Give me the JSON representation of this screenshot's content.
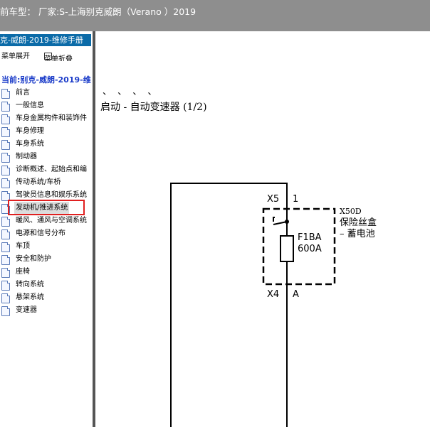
{
  "header": {
    "title": "前车型： 厂家:S-上海别克威朗（Verano ）2019"
  },
  "sidebar": {
    "manual_title": "克-威朗-2019-维修手册",
    "toolbar": {
      "expand_label": "菜单展开",
      "collapse_label": "菜单折叠"
    },
    "current_label": "当前:别克-威朗-2019-维",
    "items": [
      {
        "label": "前言"
      },
      {
        "label": "一般信息"
      },
      {
        "label": "车身金属构件和装饰件"
      },
      {
        "label": "车身修理"
      },
      {
        "label": "车身系统"
      },
      {
        "label": "制动器"
      },
      {
        "label": "诊断概述、起始点和编"
      },
      {
        "label": "传动系统/车桥"
      },
      {
        "label": "驾驶员信息和娱乐系统"
      },
      {
        "label": "发动机/推进系统"
      },
      {
        "label": "暖风、通风与空调系统"
      },
      {
        "label": "电源和信号分布"
      },
      {
        "label": "车顶"
      },
      {
        "label": "安全和防护"
      },
      {
        "label": "座椅"
      },
      {
        "label": "转向系统"
      },
      {
        "label": "悬架系统"
      },
      {
        "label": "变速器"
      }
    ],
    "selected_index": 9
  },
  "content": {
    "tick_marks": "、 、 、 、",
    "heading": "启动 - 自动变速器 (1/2)",
    "diagram": {
      "connector_top": "X5",
      "pin_top": "1",
      "fuse_id": "F1BA",
      "fuse_rating": "600A",
      "box_id": "X50D",
      "box_name": "保险丝盒",
      "box_sub": "– 蓄电池",
      "connector_bottom": "X4",
      "pin_bottom": "A"
    }
  }
}
